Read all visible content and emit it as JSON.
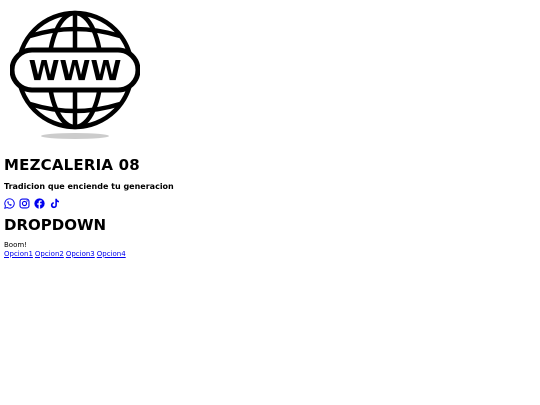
{
  "logo": {
    "icon": "globe-www-icon",
    "text": "WWW"
  },
  "header": {
    "title": "MEZCALERIA 08",
    "tagline": "Tradicion que enciende tu generacion"
  },
  "social": {
    "icons": [
      "whatsapp-icon",
      "instagram-icon",
      "facebook-icon",
      "tiktok-icon"
    ],
    "color": "#0000ee"
  },
  "dropdown": {
    "title": "DROPDOWN",
    "text": "Boom!",
    "options": [
      "Opcion1",
      "Opcion2",
      "Opcion3",
      "Opcion4"
    ]
  }
}
